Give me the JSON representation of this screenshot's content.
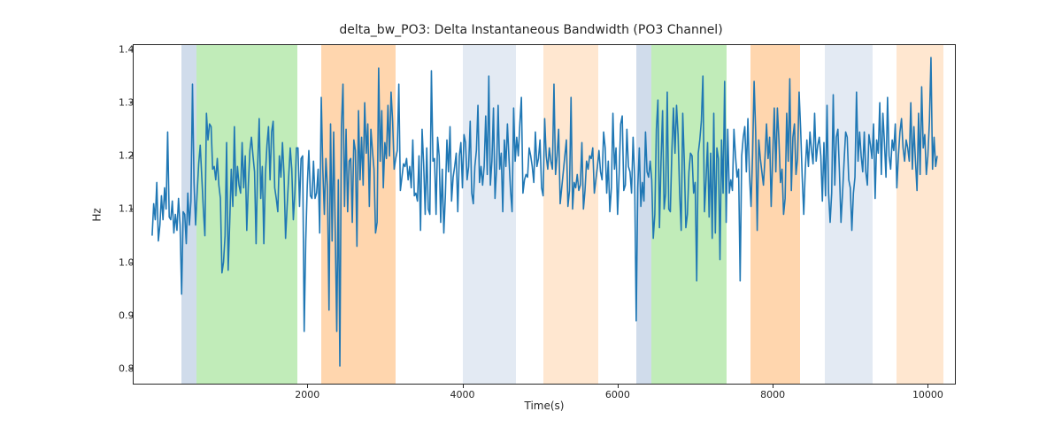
{
  "chart_data": {
    "type": "line",
    "title": "delta_bw_PO3: Delta Instantaneous Bandwidth (PO3 Channel)",
    "xlabel": "Time(s)",
    "ylabel": "Hz",
    "xlim": [
      -250,
      10360
    ],
    "ylim": [
      0.77,
      1.41
    ],
    "xticks": [
      2000,
      4000,
      6000,
      8000,
      10000
    ],
    "yticks": [
      0.8,
      0.9,
      1.0,
      1.1,
      1.2,
      1.3,
      1.4
    ],
    "shaded_regions": [
      {
        "x0": 380,
        "x1": 570,
        "color": "#b0c4de",
        "alpha": 0.6
      },
      {
        "x0": 570,
        "x1": 1870,
        "color": "#98df8a",
        "alpha": 0.6
      },
      {
        "x0": 2180,
        "x1": 3140,
        "color": "#ffbb78",
        "alpha": 0.6
      },
      {
        "x0": 4010,
        "x1": 4690,
        "color": "#b0c4de",
        "alpha": 0.35
      },
      {
        "x0": 5040,
        "x1": 5750,
        "color": "#ffbb78",
        "alpha": 0.35
      },
      {
        "x0": 6240,
        "x1": 6440,
        "color": "#b0c4de",
        "alpha": 0.6
      },
      {
        "x0": 6440,
        "x1": 7410,
        "color": "#98df8a",
        "alpha": 0.6
      },
      {
        "x0": 7710,
        "x1": 8350,
        "color": "#ffbb78",
        "alpha": 0.6
      },
      {
        "x0": 8670,
        "x1": 9290,
        "color": "#b0c4de",
        "alpha": 0.35
      },
      {
        "x0": 9590,
        "x1": 10200,
        "color": "#ffbb78",
        "alpha": 0.35
      }
    ],
    "series": [
      {
        "name": "delta_bw_PO3",
        "x_start": 0,
        "x_step": 20,
        "values": [
          1.05,
          1.11,
          1.08,
          1.15,
          1.04,
          1.07,
          1.125,
          1.08,
          1.14,
          1.1,
          1.245,
          1.085,
          1.08,
          1.115,
          1.055,
          1.09,
          1.06,
          1.12,
          1.07,
          0.94,
          1.095,
          1.09,
          1.035,
          1.13,
          1.07,
          1.115,
          1.335,
          1.15,
          1.07,
          1.13,
          1.185,
          1.22,
          1.16,
          1.1,
          1.05,
          1.28,
          1.23,
          1.26,
          1.255,
          1.175,
          1.18,
          1.155,
          1.195,
          1.145,
          1.12,
          0.98,
          1.0,
          1.05,
          1.225,
          0.985,
          1.075,
          1.175,
          1.105,
          1.255,
          1.125,
          1.18,
          1.145,
          1.13,
          1.225,
          1.14,
          1.2,
          1.06,
          1.145,
          1.21,
          1.235,
          1.2,
          1.17,
          1.035,
          1.18,
          1.27,
          1.12,
          1.18,
          1.035,
          1.165,
          1.22,
          1.255,
          1.155,
          1.245,
          1.265,
          1.14,
          1.12,
          1.095,
          1.2,
          1.16,
          1.225,
          1.165,
          1.045,
          1.105,
          1.16,
          1.215,
          1.175,
          1.08,
          1.13,
          1.215,
          1.215,
          1.105,
          1.195,
          1.2,
          0.87,
          1.04,
          1.145,
          1.21,
          1.125,
          1.12,
          1.19,
          1.12,
          1.13,
          1.175,
          1.055,
          1.31,
          1.175,
          1.09,
          1.195,
          1.14,
          0.91,
          1.26,
          1.04,
          1.245,
          1.06,
          0.87,
          1.155,
          0.805,
          1.255,
          1.335,
          1.105,
          1.25,
          1.095,
          1.19,
          1.195,
          1.075,
          1.23,
          1.21,
          1.03,
          1.285,
          1.155,
          1.235,
          1.145,
          1.3,
          1.205,
          1.26,
          1.105,
          1.25,
          1.21,
          1.175,
          1.055,
          1.075,
          1.365,
          1.19,
          1.285,
          1.14,
          1.225,
          1.195,
          1.295,
          1.2,
          1.32,
          1.265,
          1.175,
          1.195,
          1.21,
          1.335,
          1.135,
          1.16,
          1.185,
          1.18,
          1.195,
          1.155,
          1.18,
          1.14,
          1.23,
          1.125,
          1.13,
          1.115,
          1.2,
          1.06,
          1.25,
          1.185,
          1.09,
          1.215,
          1.1,
          1.09,
          1.36,
          1.19,
          1.195,
          1.09,
          1.235,
          1.2,
          1.075,
          1.175,
          1.055,
          1.125,
          1.23,
          1.17,
          1.255,
          1.115,
          1.16,
          1.18,
          1.205,
          1.095,
          1.2,
          1.225,
          1.14,
          1.24,
          1.225,
          1.155,
          1.18,
          1.265,
          1.13,
          1.11,
          1.18,
          1.21,
          1.295,
          1.15,
          1.18,
          1.145,
          1.18,
          1.275,
          1.165,
          1.35,
          1.145,
          1.19,
          1.29,
          1.12,
          1.175,
          1.295,
          1.175,
          1.205,
          1.095,
          1.23,
          1.18,
          1.26,
          1.195,
          1.135,
          1.095,
          1.29,
          1.19,
          1.235,
          1.2,
          1.26,
          1.31,
          1.13,
          1.155,
          1.165,
          1.16,
          1.215,
          1.2,
          1.18,
          1.15,
          1.245,
          1.18,
          1.195,
          1.23,
          1.14,
          1.125,
          1.27,
          1.2,
          1.175,
          1.215,
          1.19,
          1.175,
          1.335,
          1.165,
          1.2,
          1.25,
          1.11,
          1.14,
          1.17,
          1.2,
          1.23,
          1.105,
          1.135,
          1.31,
          1.1,
          1.15,
          1.14,
          1.165,
          1.135,
          1.145,
          1.225,
          1.1,
          1.135,
          1.19,
          1.175,
          1.2,
          1.195,
          1.215,
          1.13,
          1.155,
          1.18,
          1.21,
          1.17,
          1.155,
          1.245,
          1.215,
          1.13,
          1.19,
          1.095,
          1.14,
          1.28,
          1.175,
          1.215,
          1.09,
          1.165,
          1.26,
          1.275,
          1.135,
          1.145,
          1.25,
          1.18,
          1.17,
          1.13,
          1.235,
          1.16,
          0.89,
          1.14,
          1.215,
          1.105,
          1.15,
          1.115,
          1.245,
          1.17,
          1.16,
          1.19,
          1.155,
          1.045,
          1.09,
          1.25,
          1.305,
          1.065,
          1.19,
          1.285,
          1.1,
          1.13,
          1.32,
          1.1,
          1.095,
          1.21,
          1.29,
          1.205,
          1.295,
          1.24,
          1.13,
          1.06,
          1.28,
          1.19,
          1.065,
          1.09,
          1.17,
          1.205,
          1.2,
          1.13,
          1.15,
          0.965,
          1.205,
          1.23,
          1.265,
          1.35,
          1.095,
          1.155,
          1.225,
          1.085,
          1.205,
          1.045,
          1.28,
          1.055,
          1.215,
          1.195,
          1.005,
          1.23,
          1.13,
          1.34,
          1.075,
          1.25,
          1.13,
          1.155,
          1.135,
          1.25,
          1.2,
          1.16,
          1.175,
          0.965,
          1.2,
          1.235,
          1.255,
          1.17,
          1.27,
          1.165,
          1.105,
          1.2,
          1.34,
          1.245,
          1.06,
          1.23,
          1.195,
          1.17,
          1.145,
          1.195,
          1.26,
          1.195,
          1.235,
          1.105,
          1.2,
          1.29,
          1.17,
          1.29,
          1.23,
          1.15,
          1.175,
          1.09,
          1.12,
          1.28,
          1.19,
          1.345,
          1.135,
          1.235,
          1.26,
          1.165,
          1.195,
          1.32,
          1.25,
          1.16,
          1.09,
          1.175,
          1.23,
          1.18,
          1.245,
          1.21,
          1.185,
          1.28,
          1.19,
          1.22,
          1.235,
          1.2,
          1.115,
          1.225,
          1.125,
          1.295,
          1.13,
          1.075,
          1.13,
          1.315,
          1.145,
          1.235,
          1.25,
          1.17,
          1.075,
          1.13,
          1.19,
          1.245,
          1.235,
          1.155,
          1.14,
          1.06,
          1.13,
          1.16,
          1.32,
          1.19,
          1.245,
          1.2,
          1.17,
          1.245,
          1.17,
          1.145,
          1.24,
          1.22,
          1.195,
          1.26,
          1.12,
          1.23,
          1.205,
          1.3,
          1.165,
          1.28,
          1.225,
          1.16,
          1.31,
          1.2,
          1.175,
          1.23,
          1.21,
          1.26,
          1.14,
          1.2,
          1.245,
          1.27,
          1.215,
          1.19,
          1.23,
          1.215,
          1.19,
          1.3,
          1.175,
          1.255,
          1.19,
          1.135,
          1.28,
          1.165,
          1.33,
          1.215,
          1.24,
          1.165,
          1.2,
          1.265,
          1.385,
          1.175,
          1.235,
          1.18,
          1.2
        ]
      }
    ]
  }
}
